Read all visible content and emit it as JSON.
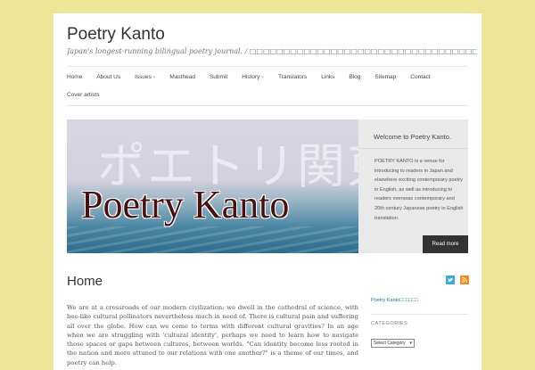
{
  "site": {
    "title": "Poetry Kanto",
    "tagline": "Japan's longest-running bilingual poetry journal. / □□□□□□□□□□□□□□□□□□□□□□□□□□□□□□□□□□□□□□□□□□□□"
  },
  "nav": {
    "row1": [
      {
        "label": "Home",
        "dropdown": false
      },
      {
        "label": "About Us",
        "dropdown": false
      },
      {
        "label": "Issues",
        "dropdown": true
      },
      {
        "label": "Masthead",
        "dropdown": false
      },
      {
        "label": "Submit",
        "dropdown": false
      },
      {
        "label": "History",
        "dropdown": true
      },
      {
        "label": "Translators",
        "dropdown": false
      },
      {
        "label": "Links",
        "dropdown": false
      },
      {
        "label": "Blog",
        "dropdown": false
      },
      {
        "label": "Sitemap",
        "dropdown": false
      },
      {
        "label": "Contact",
        "dropdown": false
      }
    ],
    "row2": [
      {
        "label": "Cover artists",
        "dropdown": false
      }
    ]
  },
  "hero": {
    "kanji_overlay": "ポエトリ関東",
    "title": "Poetry Kanto"
  },
  "welcome": {
    "title": "Welcome to Poetry Kanto.",
    "text": "POETRY KANTO is a venue for introducing to readers in Japan and elsewhere exciting contemporary poetry in English, as well as introducing to readers overseas contemporary and 20th century Japanese poetry in English translation.",
    "button": "Read more"
  },
  "main": {
    "heading": "Home",
    "body": "We are at a crossroads of our modern civilization: we dwell in the cathedral of science, with bee-like cultural pollinators nevertheless much in need of. There is cultural pain and suffering all over the globe. How can we come to terms with different cultural gravities? In an age when we are struggling with 'cultural identity', perhaps we need to learn how to navigate those spaces or gaps between cultures, between worlds. \"Can identity become less rooted in the nation and more attuned to our relations with one another?\" is a theme of our times, and poetry can help."
  },
  "sidebar": {
    "link": "Poetry Kanto□□□□□□",
    "categories_heading": "CATEGORIES",
    "select_value": "Select Category",
    "twitter_icon": "twitter-icon",
    "rss_icon": "rss-icon"
  },
  "colors": {
    "background": "#efe596",
    "button": "#333333",
    "twitter": "#39a9e0",
    "rss": "#f58a1f",
    "link": "#21759b"
  }
}
